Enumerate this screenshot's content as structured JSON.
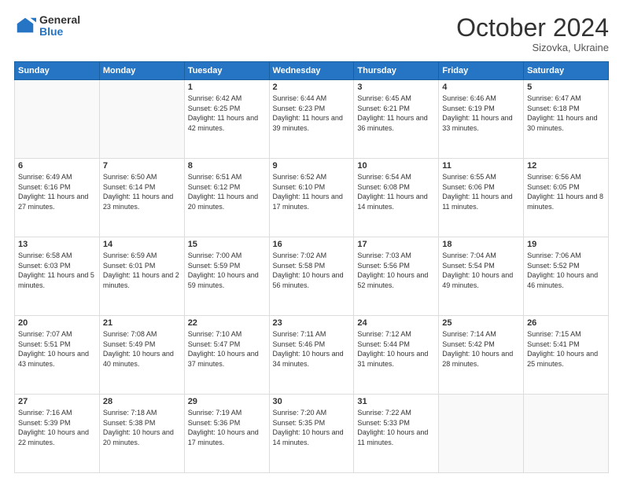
{
  "header": {
    "logo_general": "General",
    "logo_blue": "Blue",
    "month": "October 2024",
    "location": "Sizovka, Ukraine"
  },
  "days_of_week": [
    "Sunday",
    "Monday",
    "Tuesday",
    "Wednesday",
    "Thursday",
    "Friday",
    "Saturday"
  ],
  "weeks": [
    [
      {
        "day": "",
        "info": ""
      },
      {
        "day": "",
        "info": ""
      },
      {
        "day": "1",
        "info": "Sunrise: 6:42 AM\nSunset: 6:25 PM\nDaylight: 11 hours and 42 minutes."
      },
      {
        "day": "2",
        "info": "Sunrise: 6:44 AM\nSunset: 6:23 PM\nDaylight: 11 hours and 39 minutes."
      },
      {
        "day": "3",
        "info": "Sunrise: 6:45 AM\nSunset: 6:21 PM\nDaylight: 11 hours and 36 minutes."
      },
      {
        "day": "4",
        "info": "Sunrise: 6:46 AM\nSunset: 6:19 PM\nDaylight: 11 hours and 33 minutes."
      },
      {
        "day": "5",
        "info": "Sunrise: 6:47 AM\nSunset: 6:18 PM\nDaylight: 11 hours and 30 minutes."
      }
    ],
    [
      {
        "day": "6",
        "info": "Sunrise: 6:49 AM\nSunset: 6:16 PM\nDaylight: 11 hours and 27 minutes."
      },
      {
        "day": "7",
        "info": "Sunrise: 6:50 AM\nSunset: 6:14 PM\nDaylight: 11 hours and 23 minutes."
      },
      {
        "day": "8",
        "info": "Sunrise: 6:51 AM\nSunset: 6:12 PM\nDaylight: 11 hours and 20 minutes."
      },
      {
        "day": "9",
        "info": "Sunrise: 6:52 AM\nSunset: 6:10 PM\nDaylight: 11 hours and 17 minutes."
      },
      {
        "day": "10",
        "info": "Sunrise: 6:54 AM\nSunset: 6:08 PM\nDaylight: 11 hours and 14 minutes."
      },
      {
        "day": "11",
        "info": "Sunrise: 6:55 AM\nSunset: 6:06 PM\nDaylight: 11 hours and 11 minutes."
      },
      {
        "day": "12",
        "info": "Sunrise: 6:56 AM\nSunset: 6:05 PM\nDaylight: 11 hours and 8 minutes."
      }
    ],
    [
      {
        "day": "13",
        "info": "Sunrise: 6:58 AM\nSunset: 6:03 PM\nDaylight: 11 hours and 5 minutes."
      },
      {
        "day": "14",
        "info": "Sunrise: 6:59 AM\nSunset: 6:01 PM\nDaylight: 11 hours and 2 minutes."
      },
      {
        "day": "15",
        "info": "Sunrise: 7:00 AM\nSunset: 5:59 PM\nDaylight: 10 hours and 59 minutes."
      },
      {
        "day": "16",
        "info": "Sunrise: 7:02 AM\nSunset: 5:58 PM\nDaylight: 10 hours and 56 minutes."
      },
      {
        "day": "17",
        "info": "Sunrise: 7:03 AM\nSunset: 5:56 PM\nDaylight: 10 hours and 52 minutes."
      },
      {
        "day": "18",
        "info": "Sunrise: 7:04 AM\nSunset: 5:54 PM\nDaylight: 10 hours and 49 minutes."
      },
      {
        "day": "19",
        "info": "Sunrise: 7:06 AM\nSunset: 5:52 PM\nDaylight: 10 hours and 46 minutes."
      }
    ],
    [
      {
        "day": "20",
        "info": "Sunrise: 7:07 AM\nSunset: 5:51 PM\nDaylight: 10 hours and 43 minutes."
      },
      {
        "day": "21",
        "info": "Sunrise: 7:08 AM\nSunset: 5:49 PM\nDaylight: 10 hours and 40 minutes."
      },
      {
        "day": "22",
        "info": "Sunrise: 7:10 AM\nSunset: 5:47 PM\nDaylight: 10 hours and 37 minutes."
      },
      {
        "day": "23",
        "info": "Sunrise: 7:11 AM\nSunset: 5:46 PM\nDaylight: 10 hours and 34 minutes."
      },
      {
        "day": "24",
        "info": "Sunrise: 7:12 AM\nSunset: 5:44 PM\nDaylight: 10 hours and 31 minutes."
      },
      {
        "day": "25",
        "info": "Sunrise: 7:14 AM\nSunset: 5:42 PM\nDaylight: 10 hours and 28 minutes."
      },
      {
        "day": "26",
        "info": "Sunrise: 7:15 AM\nSunset: 5:41 PM\nDaylight: 10 hours and 25 minutes."
      }
    ],
    [
      {
        "day": "27",
        "info": "Sunrise: 7:16 AM\nSunset: 5:39 PM\nDaylight: 10 hours and 22 minutes."
      },
      {
        "day": "28",
        "info": "Sunrise: 7:18 AM\nSunset: 5:38 PM\nDaylight: 10 hours and 20 minutes."
      },
      {
        "day": "29",
        "info": "Sunrise: 7:19 AM\nSunset: 5:36 PM\nDaylight: 10 hours and 17 minutes."
      },
      {
        "day": "30",
        "info": "Sunrise: 7:20 AM\nSunset: 5:35 PM\nDaylight: 10 hours and 14 minutes."
      },
      {
        "day": "31",
        "info": "Sunrise: 7:22 AM\nSunset: 5:33 PM\nDaylight: 10 hours and 11 minutes."
      },
      {
        "day": "",
        "info": ""
      },
      {
        "day": "",
        "info": ""
      }
    ]
  ]
}
